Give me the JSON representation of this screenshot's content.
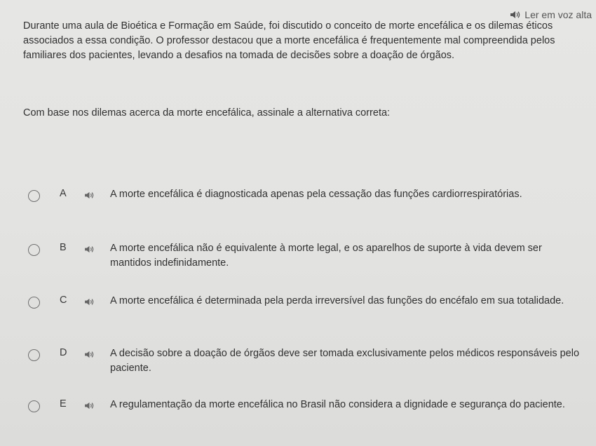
{
  "read_aloud": {
    "label": "Ler em voz alta"
  },
  "statement": "Durante uma aula de Bioética e Formação em Saúde, foi discutido o conceito de morte encefálica e os dilemas éticos associados a essa condição. O professor destacou que a morte encefálica é frequentemente mal compreendida pelos familiares dos pacientes, levando a desafios na tomada de decisões sobre a doação de órgãos.",
  "question": "Com base nos dilemas acerca da morte encefálica, assinale a alternativa correta:",
  "options": [
    {
      "letter": "A",
      "text": "A morte encefálica é diagnosticada apenas pela cessação das funções cardiorrespiratórias."
    },
    {
      "letter": "B",
      "text": "A morte encefálica não é equivalente à morte legal, e os aparelhos de suporte à vida devem ser mantidos indefinidamente."
    },
    {
      "letter": "C",
      "text": "A morte encefálica é determinada pela perda irreversível das funções do encéfalo em sua totalidade."
    },
    {
      "letter": "D",
      "text": "A decisão sobre a doação de órgãos deve ser tomada exclusivamente pelos médicos responsáveis pelo paciente."
    },
    {
      "letter": "E",
      "text": "A regulamentação da morte encefálica no Brasil não considera a dignidade e segurança do paciente."
    }
  ]
}
